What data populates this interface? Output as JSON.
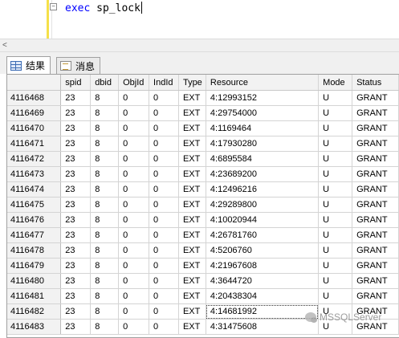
{
  "editor": {
    "keyword": "exec",
    "procedure": " sp_lock",
    "collapse_symbol": "−"
  },
  "scrollbar": {
    "left_arrow": "<"
  },
  "tabs": [
    {
      "label": "结果",
      "icon": "grid-icon",
      "active": true
    },
    {
      "label": "消息",
      "icon": "message-icon",
      "active": false
    }
  ],
  "grid": {
    "columns": [
      "",
      "spid",
      "dbid",
      "ObjId",
      "IndId",
      "Type",
      "Resource",
      "Mode",
      "Status"
    ],
    "rows": [
      [
        "4116468",
        "23",
        "8",
        "0",
        "0",
        "EXT",
        "4:12993152",
        "U",
        "GRANT"
      ],
      [
        "4116469",
        "23",
        "8",
        "0",
        "0",
        "EXT",
        "4:29754000",
        "U",
        "GRANT"
      ],
      [
        "4116470",
        "23",
        "8",
        "0",
        "0",
        "EXT",
        "4:1169464",
        "U",
        "GRANT"
      ],
      [
        "4116471",
        "23",
        "8",
        "0",
        "0",
        "EXT",
        "4:17930280",
        "U",
        "GRANT"
      ],
      [
        "4116472",
        "23",
        "8",
        "0",
        "0",
        "EXT",
        "4:6895584",
        "U",
        "GRANT"
      ],
      [
        "4116473",
        "23",
        "8",
        "0",
        "0",
        "EXT",
        "4:23689200",
        "U",
        "GRANT"
      ],
      [
        "4116474",
        "23",
        "8",
        "0",
        "0",
        "EXT",
        "4:12496216",
        "U",
        "GRANT"
      ],
      [
        "4116475",
        "23",
        "8",
        "0",
        "0",
        "EXT",
        "4:29289800",
        "U",
        "GRANT"
      ],
      [
        "4116476",
        "23",
        "8",
        "0",
        "0",
        "EXT",
        "4:10020944",
        "U",
        "GRANT"
      ],
      [
        "4116477",
        "23",
        "8",
        "0",
        "0",
        "EXT",
        "4:26781760",
        "U",
        "GRANT"
      ],
      [
        "4116478",
        "23",
        "8",
        "0",
        "0",
        "EXT",
        "4:5206760",
        "U",
        "GRANT"
      ],
      [
        "4116479",
        "23",
        "8",
        "0",
        "0",
        "EXT",
        "4:21967608",
        "U",
        "GRANT"
      ],
      [
        "4116480",
        "23",
        "8",
        "0",
        "0",
        "EXT",
        "4:3644720",
        "U",
        "GRANT"
      ],
      [
        "4116481",
        "23",
        "8",
        "0",
        "0",
        "EXT",
        "4:20438304",
        "U",
        "GRANT"
      ],
      [
        "4116482",
        "23",
        "8",
        "0",
        "0",
        "EXT",
        "4:14681992",
        "U",
        "GRANT"
      ],
      [
        "4116483",
        "23",
        "8",
        "0",
        "0",
        "EXT",
        "4:31475608",
        "U",
        "GRANT"
      ]
    ],
    "selected_row_index": 14
  },
  "watermark": {
    "text": "MSSQLServer"
  }
}
